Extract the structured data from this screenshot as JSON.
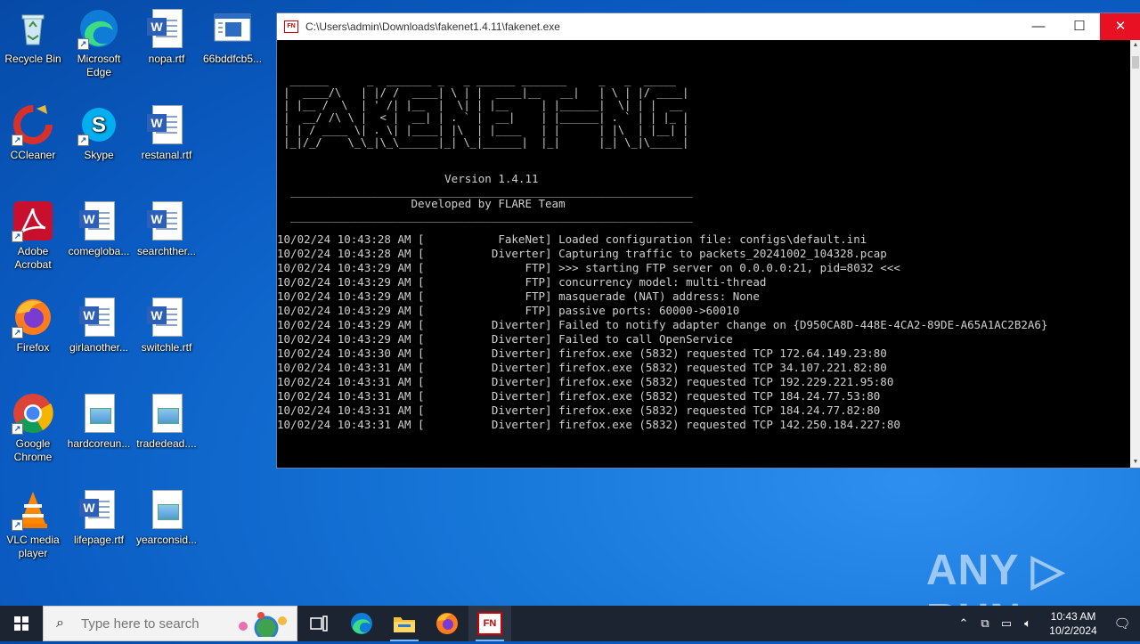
{
  "desktop": {
    "icons": [
      {
        "label": "Recycle Bin"
      },
      {
        "label": "Microsoft Edge"
      },
      {
        "label": "nopa.rtf"
      },
      {
        "label": "66bddfcb5..."
      },
      {
        "label": "CCleaner"
      },
      {
        "label": "Skype"
      },
      {
        "label": "restanal.rtf"
      },
      {
        "label": "Adobe Acrobat"
      },
      {
        "label": "comegloba..."
      },
      {
        "label": "searchther..."
      },
      {
        "label": "Firefox"
      },
      {
        "label": "girlanother..."
      },
      {
        "label": "switchle.rtf"
      },
      {
        "label": "Google Chrome"
      },
      {
        "label": "hardcoreun..."
      },
      {
        "label": "tradedead...."
      },
      {
        "label": "VLC media player"
      },
      {
        "label": "lifepage.rtf"
      },
      {
        "label": "yearconsid..."
      }
    ]
  },
  "window": {
    "title": "C:\\Users\\admin\\Downloads\\fakenet1.4.11\\fakenet.exe",
    "app_icon_text": "FN",
    "minimize": "—",
    "maximize": "☐",
    "close": "✕"
  },
  "console": {
    "banner": "  ______      _  _______ _   _ ______ _______     _   _  _____\n |  ____/\\   | |/ /  ____| \\ | |  ____|__   __|   | \\ | |/ ____|\n | |__ /  \\  | ' /| |__  |  \\| | |__     | |______|  \\| | |  __\n |  __/ /\\ \\ |  < |  __| | . ` |  __|    | |______| . ` | | |_ |\n | | / ____ \\| . \\| |____| |\\  | |____   | |      | |\\  | |__| |\n |_|/_/    \\_\\_|\\_\\______|_| \\_|______|  |_|      |_| \\_|\\_____|",
    "version": "                         Version 1.4.11",
    "rule1": "  ____________________________________________________________",
    "developed": "                    Developed by FLARE Team",
    "rule2": "  ____________________________________________________________",
    "lines": [
      "10/02/24 10:43:28 AM [           FakeNet] Loaded configuration file: configs\\default.ini",
      "10/02/24 10:43:28 AM [          Diverter] Capturing traffic to packets_20241002_104328.pcap",
      "10/02/24 10:43:29 AM [               FTP] >>> starting FTP server on 0.0.0.0:21, pid=8032 <<<",
      "10/02/24 10:43:29 AM [               FTP] concurrency model: multi-thread",
      "10/02/24 10:43:29 AM [               FTP] masquerade (NAT) address: None",
      "10/02/24 10:43:29 AM [               FTP] passive ports: 60000->60010",
      "10/02/24 10:43:29 AM [          Diverter] Failed to notify adapter change on {D950CA8D-448E-4CA2-89DE-A65A1AC2B2A6}",
      "10/02/24 10:43:29 AM [          Diverter] Failed to call OpenService",
      "10/02/24 10:43:30 AM [          Diverter] firefox.exe (5832) requested TCP 172.64.149.23:80",
      "10/02/24 10:43:31 AM [          Diverter] firefox.exe (5832) requested TCP 34.107.221.82:80",
      "10/02/24 10:43:31 AM [          Diverter] firefox.exe (5832) requested TCP 192.229.221.95:80",
      "10/02/24 10:43:31 AM [          Diverter] firefox.exe (5832) requested TCP 184.24.77.53:80",
      "10/02/24 10:43:31 AM [          Diverter] firefox.exe (5832) requested TCP 184.24.77.82:80",
      "10/02/24 10:43:31 AM [          Diverter] firefox.exe (5832) requested TCP 142.250.184.227:80"
    ]
  },
  "watermark": "ANY ▷ RUN",
  "taskbar": {
    "search_placeholder": "Type here to search",
    "pinned": [
      "task-view",
      "edge",
      "file-explorer",
      "firefox",
      "fakenet"
    ],
    "fakenet_label": "FN",
    "time": "10:43 AM",
    "date": "10/2/2024"
  }
}
